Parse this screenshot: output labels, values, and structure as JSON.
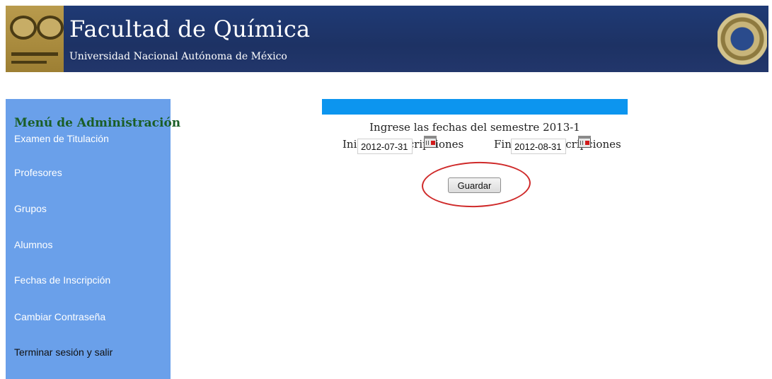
{
  "header": {
    "title": "Facultad de Química",
    "subtitle": "Universidad Nacional Autónoma de México"
  },
  "sidebar": {
    "title": "Menú de Administración",
    "items": [
      {
        "label": "Examen de Titulación"
      },
      {
        "label": "Profesores"
      },
      {
        "label": "Grupos"
      },
      {
        "label": "Alumnos"
      },
      {
        "label": "Fechas de Inscripción"
      },
      {
        "label": "Cambiar Contraseña"
      },
      {
        "label": "Terminar sesión y salir"
      }
    ]
  },
  "form": {
    "instruction": "Ingrese las fechas del semestre 2013-1",
    "start_label": "Inicio de inscripciones",
    "end_label": "Fin de las inscripciones",
    "start_value": "2012-07-31",
    "end_value": "2012-08-31",
    "save_label": "Guardar"
  },
  "icons": {
    "logo": "faculty-logo",
    "seal": "unam-seal",
    "calendar": "calendar-icon"
  },
  "colors": {
    "header_bg": "#1d3264",
    "sidebar_bg": "#6aa0ea",
    "accent_bar": "#0c95ef",
    "sidebar_title": "#1a5e27",
    "highlight_circle": "#cf2a2a"
  }
}
